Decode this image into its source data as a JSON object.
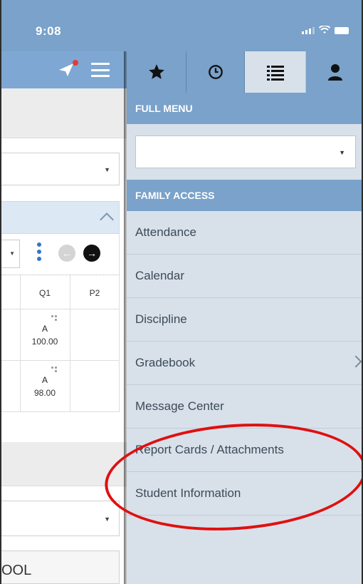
{
  "status_bar": {
    "time": "9:08"
  },
  "left_page": {
    "grid_headers": [
      "Q1",
      "P2"
    ],
    "grades": [
      {
        "letter": "A",
        "percent": "100.00"
      },
      {
        "letter": "A",
        "percent": "98.00"
      }
    ],
    "school_text": "OOL"
  },
  "panel": {
    "tabs": [
      {
        "icon": "star-icon"
      },
      {
        "icon": "clock-icon"
      },
      {
        "icon": "list-icon"
      },
      {
        "icon": "person-icon"
      }
    ],
    "full_menu_label": "FULL MENU",
    "family_access_label": "FAMILY ACCESS",
    "menu_items": [
      "Attendance",
      "Calendar",
      "Discipline",
      "Gradebook",
      "Message Center",
      "Report Cards / Attachments",
      "Student Information"
    ]
  },
  "colors": {
    "header_blue": "#7aa2ca",
    "panel_bg": "#d8e1ea",
    "annotation_red": "#e01010"
  }
}
